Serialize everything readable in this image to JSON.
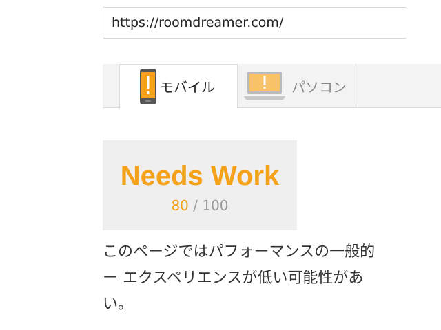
{
  "url_box": {
    "value": "https://roomdreamer.com/"
  },
  "tabs": [
    {
      "label": "モバイル",
      "icon": "warning-phone-icon",
      "selected": true
    },
    {
      "label": "パソコン",
      "icon": "warning-laptop-icon",
      "selected": false
    }
  ],
  "score": {
    "status": "Needs Work",
    "value": "80",
    "separator": "/",
    "max": "100"
  },
  "description": {
    "line1": "このページではパフォーマンスの一般的",
    "line2": "ー エクスペリエンスが低い可能性があ",
    "line3": "い。"
  },
  "colors": {
    "accent": "#f6a11a",
    "tab_strip": "#f3f3f3",
    "score_bg": "#efefef"
  }
}
